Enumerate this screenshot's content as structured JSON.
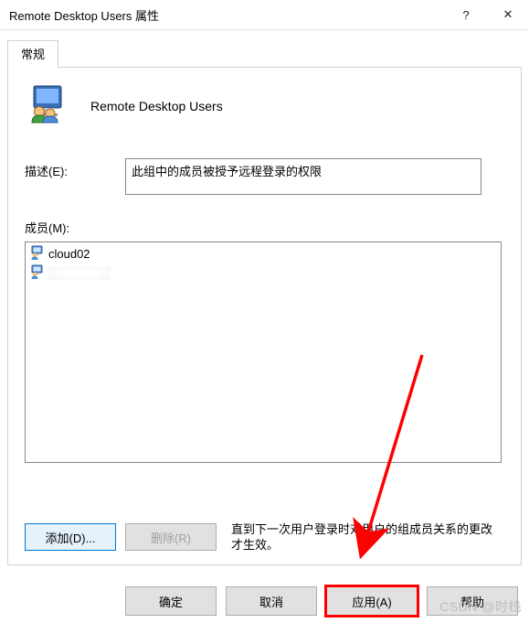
{
  "titlebar": {
    "title": "Remote Desktop Users 属性",
    "help": "?",
    "close": "✕"
  },
  "tab": {
    "general": "常规"
  },
  "group": {
    "name": "Remote Desktop Users"
  },
  "description": {
    "label": "描述(E):",
    "value": "此组中的成员被授予远程登录的权限"
  },
  "members": {
    "label": "成员(M):",
    "items": [
      {
        "name": "cloud02"
      },
      {
        "name": ""
      }
    ]
  },
  "actions": {
    "add": "添加(D)...",
    "remove": "删除(R)",
    "note": "直到下一次用户登录时对用户的组成员关系的更改才生效。"
  },
  "dialog": {
    "ok": "确定",
    "cancel": "取消",
    "apply": "应用(A)",
    "help": "帮助"
  },
  "watermark": "CSDN @时栈"
}
